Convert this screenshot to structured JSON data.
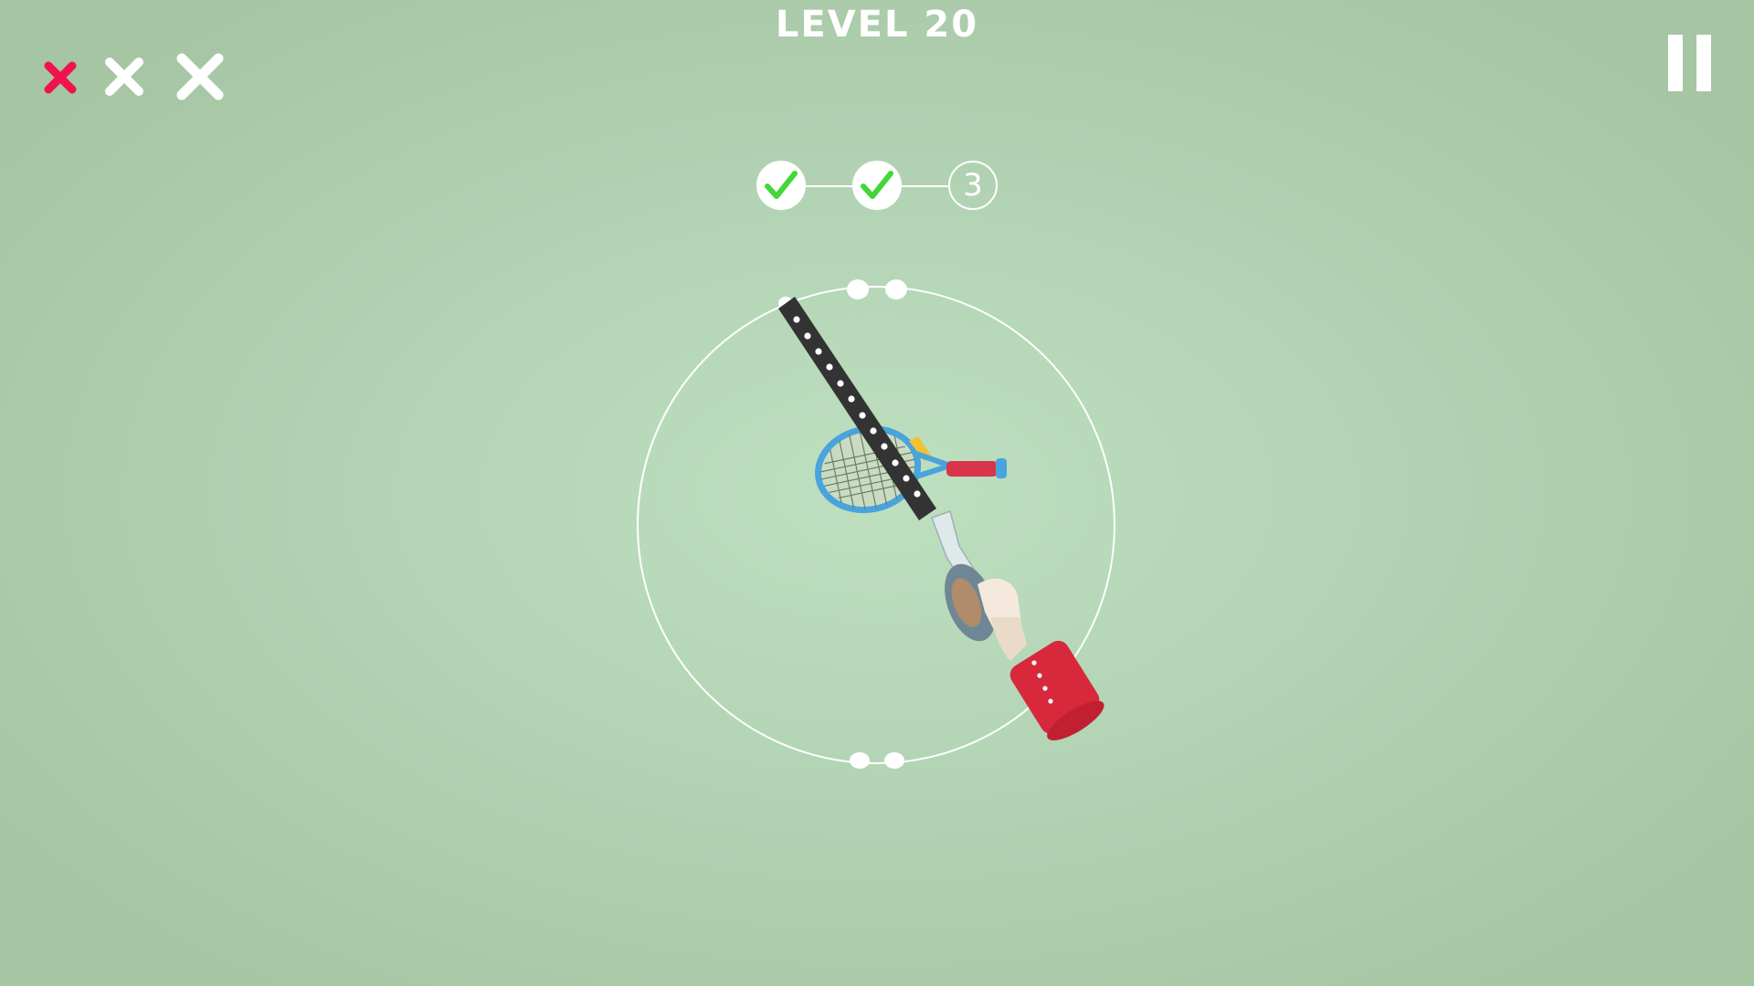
{
  "hud": {
    "level_title": "LEVEL 20",
    "strikes": [
      {
        "icon": "x-mark-icon",
        "state": "used",
        "color": "#f0134d"
      },
      {
        "icon": "x-mark-icon",
        "state": "remaining",
        "color": "#ffffff"
      },
      {
        "icon": "x-mark-icon",
        "state": "remaining",
        "color": "#ffffff"
      }
    ],
    "pause_icon": "pause-icon"
  },
  "stage_progress": {
    "stages": [
      {
        "state": "completed",
        "icon": "checkmark-icon"
      },
      {
        "state": "completed",
        "icon": "checkmark-icon"
      },
      {
        "state": "current",
        "label": "3"
      }
    ],
    "check_color": "#44d63a"
  },
  "scene": {
    "target_item": "tennis-racket",
    "tool": "tape-dispenser",
    "colors": {
      "ring": "#ffffff",
      "tape_strip": "#333333",
      "racket_frame": "#4aa3dc",
      "racket_handle": "#d9354a",
      "sleeve": "#d8283c",
      "hand": "#f4e9dc"
    }
  }
}
